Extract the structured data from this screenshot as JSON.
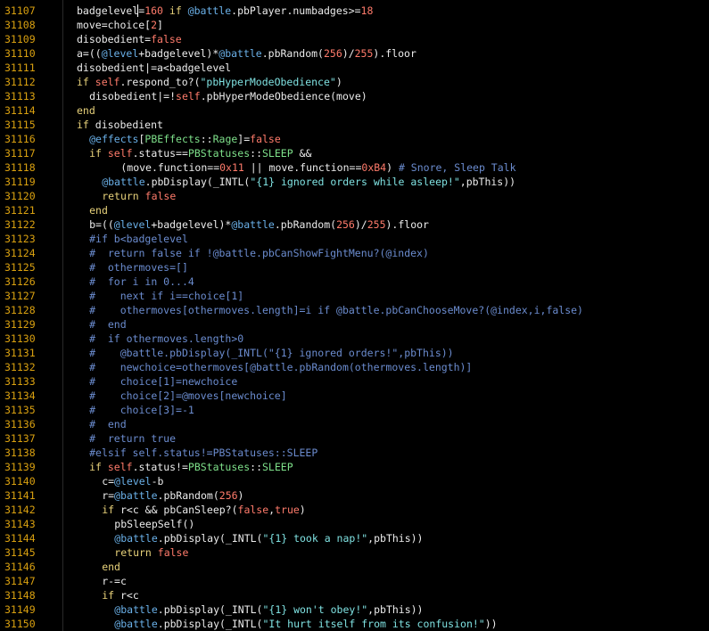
{
  "editor": {
    "lines": [
      {
        "num": "31107",
        "indent": 4,
        "tokens": [
          [
            "badgelevel",
            "plain"
          ],
          [
            "",
            "cursor"
          ],
          [
            "=",
            "plain"
          ],
          [
            "160",
            "num"
          ],
          [
            " if ",
            "kw"
          ],
          [
            "@battle",
            "iv"
          ],
          [
            ".pbPlayer.numbadges>=",
            "plain"
          ],
          [
            "18",
            "num"
          ]
        ]
      },
      {
        "num": "31108",
        "indent": 4,
        "tokens": [
          [
            "move=choice[",
            "plain"
          ],
          [
            "2",
            "num"
          ],
          [
            "]",
            "plain"
          ]
        ]
      },
      {
        "num": "31109",
        "indent": 4,
        "tokens": [
          [
            "disobedient=",
            "plain"
          ],
          [
            "false",
            "num"
          ]
        ]
      },
      {
        "num": "31110",
        "indent": 4,
        "tokens": [
          [
            "a=((",
            "plain"
          ],
          [
            "@level",
            "iv"
          ],
          [
            "+badgelevel)*",
            "plain"
          ],
          [
            "@battle",
            "iv"
          ],
          [
            ".pbRandom(",
            "plain"
          ],
          [
            "256",
            "num"
          ],
          [
            ")/",
            "plain"
          ],
          [
            "255",
            "num"
          ],
          [
            ").floor",
            "plain"
          ]
        ]
      },
      {
        "num": "31111",
        "indent": 4,
        "tokens": [
          [
            "disobedient|=a<badgelevel",
            "plain"
          ]
        ]
      },
      {
        "num": "31112",
        "indent": 4,
        "tokens": [
          [
            "if ",
            "kw"
          ],
          [
            "self",
            "num"
          ],
          [
            ".respond_to?(",
            "plain"
          ],
          [
            "\"pbHyperModeObedience\"",
            "str"
          ],
          [
            ")",
            "plain"
          ]
        ]
      },
      {
        "num": "31113",
        "indent": 6,
        "tokens": [
          [
            "disobedient|=!",
            "plain"
          ],
          [
            "self",
            "num"
          ],
          [
            ".pbHyperModeObedience(move)",
            "plain"
          ]
        ]
      },
      {
        "num": "31114",
        "indent": 4,
        "tokens": [
          [
            "end",
            "kw"
          ]
        ]
      },
      {
        "num": "31115",
        "indent": 4,
        "tokens": [
          [
            "if ",
            "kw"
          ],
          [
            "disobedient",
            "plain"
          ]
        ]
      },
      {
        "num": "31116",
        "indent": 6,
        "tokens": [
          [
            "@effects",
            "iv"
          ],
          [
            "[",
            "plain"
          ],
          [
            "PBEffects",
            "const"
          ],
          [
            "::",
            "plain"
          ],
          [
            "Rage",
            "const"
          ],
          [
            "]=",
            "plain"
          ],
          [
            "false",
            "num"
          ]
        ]
      },
      {
        "num": "31117",
        "indent": 6,
        "tokens": [
          [
            "if ",
            "kw"
          ],
          [
            "self",
            "num"
          ],
          [
            ".status==",
            "plain"
          ],
          [
            "PBStatuses",
            "const"
          ],
          [
            "::",
            "plain"
          ],
          [
            "SLEEP",
            "const"
          ],
          [
            " &&",
            "plain"
          ]
        ]
      },
      {
        "num": "31118",
        "indent": 11,
        "tokens": [
          [
            "(move.function==",
            "plain"
          ],
          [
            "0x11",
            "num"
          ],
          [
            " || move.function==",
            "plain"
          ],
          [
            "0xB4",
            "num"
          ],
          [
            ") ",
            "plain"
          ],
          [
            "# Snore, Sleep Talk",
            "cmt"
          ]
        ]
      },
      {
        "num": "31119",
        "indent": 8,
        "tokens": [
          [
            "@battle",
            "iv"
          ],
          [
            ".pbDisplay(_INTL(",
            "plain"
          ],
          [
            "\"{1} ignored orders while asleep!\"",
            "str"
          ],
          [
            ",pbThis))",
            "plain"
          ]
        ]
      },
      {
        "num": "31120",
        "indent": 8,
        "tokens": [
          [
            "return ",
            "kw"
          ],
          [
            "false",
            "num"
          ]
        ]
      },
      {
        "num": "31121",
        "indent": 6,
        "tokens": [
          [
            "end",
            "kw"
          ]
        ]
      },
      {
        "num": "31122",
        "indent": 6,
        "tokens": [
          [
            "b=((",
            "plain"
          ],
          [
            "@level",
            "iv"
          ],
          [
            "+badgelevel)*",
            "plain"
          ],
          [
            "@battle",
            "iv"
          ],
          [
            ".pbRandom(",
            "plain"
          ],
          [
            "256",
            "num"
          ],
          [
            ")/",
            "plain"
          ],
          [
            "255",
            "num"
          ],
          [
            ").floor",
            "plain"
          ]
        ]
      },
      {
        "num": "31123",
        "indent": 6,
        "tokens": [
          [
            "#if b<badgelevel",
            "cmt"
          ]
        ]
      },
      {
        "num": "31124",
        "indent": 6,
        "tokens": [
          [
            "#  return false if !@battle.pbCanShowFightMenu?(@index)",
            "cmt"
          ]
        ]
      },
      {
        "num": "31125",
        "indent": 6,
        "tokens": [
          [
            "#  othermoves=[]",
            "cmt"
          ]
        ]
      },
      {
        "num": "31126",
        "indent": 6,
        "tokens": [
          [
            "#  for i in 0...4",
            "cmt"
          ]
        ]
      },
      {
        "num": "31127",
        "indent": 6,
        "tokens": [
          [
            "#    next if i==choice[1]",
            "cmt"
          ]
        ]
      },
      {
        "num": "31128",
        "indent": 6,
        "tokens": [
          [
            "#    othermoves[othermoves.length]=i if @battle.pbCanChooseMove?(@index,i,false)",
            "cmt"
          ]
        ]
      },
      {
        "num": "31129",
        "indent": 6,
        "tokens": [
          [
            "#  end",
            "cmt"
          ]
        ]
      },
      {
        "num": "31130",
        "indent": 6,
        "tokens": [
          [
            "#  if othermoves.length>0",
            "cmt"
          ]
        ]
      },
      {
        "num": "31131",
        "indent": 6,
        "tokens": [
          [
            "#    @battle.pbDisplay(_INTL(\"{1} ignored orders!\",pbThis))",
            "cmt"
          ]
        ]
      },
      {
        "num": "31132",
        "indent": 6,
        "tokens": [
          [
            "#    newchoice=othermoves[@battle.pbRandom(othermoves.length)]",
            "cmt"
          ]
        ]
      },
      {
        "num": "31133",
        "indent": 6,
        "tokens": [
          [
            "#    choice[1]=newchoice",
            "cmt"
          ]
        ]
      },
      {
        "num": "31134",
        "indent": 6,
        "tokens": [
          [
            "#    choice[2]=@moves[newchoice]",
            "cmt"
          ]
        ]
      },
      {
        "num": "31135",
        "indent": 6,
        "tokens": [
          [
            "#    choice[3]=-1",
            "cmt"
          ]
        ]
      },
      {
        "num": "31136",
        "indent": 6,
        "tokens": [
          [
            "#  end",
            "cmt"
          ]
        ]
      },
      {
        "num": "31137",
        "indent": 6,
        "tokens": [
          [
            "#  return true",
            "cmt"
          ]
        ]
      },
      {
        "num": "31138",
        "indent": 6,
        "tokens": [
          [
            "#elsif self.status!=PBStatuses::SLEEP",
            "cmt"
          ]
        ]
      },
      {
        "num": "31139",
        "indent": 6,
        "tokens": [
          [
            "if ",
            "kw"
          ],
          [
            "self",
            "num"
          ],
          [
            ".status!=",
            "plain"
          ],
          [
            "PBStatuses",
            "const"
          ],
          [
            "::",
            "plain"
          ],
          [
            "SLEEP",
            "const"
          ]
        ]
      },
      {
        "num": "31140",
        "indent": 8,
        "tokens": [
          [
            "c=",
            "plain"
          ],
          [
            "@level",
            "iv"
          ],
          [
            "-b",
            "plain"
          ]
        ]
      },
      {
        "num": "31141",
        "indent": 8,
        "tokens": [
          [
            "r=",
            "plain"
          ],
          [
            "@battle",
            "iv"
          ],
          [
            ".pbRandom(",
            "plain"
          ],
          [
            "256",
            "num"
          ],
          [
            ")",
            "plain"
          ]
        ]
      },
      {
        "num": "31142",
        "indent": 8,
        "tokens": [
          [
            "if ",
            "kw"
          ],
          [
            "r<c && pbCanSleep?(",
            "plain"
          ],
          [
            "false",
            "num"
          ],
          [
            ",",
            "plain"
          ],
          [
            "true",
            "num"
          ],
          [
            ")",
            "plain"
          ]
        ]
      },
      {
        "num": "31143",
        "indent": 10,
        "tokens": [
          [
            "pbSleepSelf()",
            "plain"
          ]
        ]
      },
      {
        "num": "31144",
        "indent": 10,
        "tokens": [
          [
            "@battle",
            "iv"
          ],
          [
            ".pbDisplay(_INTL(",
            "plain"
          ],
          [
            "\"{1} took a nap!\"",
            "str"
          ],
          [
            ",pbThis))",
            "plain"
          ]
        ]
      },
      {
        "num": "31145",
        "indent": 10,
        "tokens": [
          [
            "return ",
            "kw"
          ],
          [
            "false",
            "num"
          ]
        ]
      },
      {
        "num": "31146",
        "indent": 8,
        "tokens": [
          [
            "end",
            "kw"
          ]
        ]
      },
      {
        "num": "31147",
        "indent": 8,
        "tokens": [
          [
            "r-=c",
            "plain"
          ]
        ]
      },
      {
        "num": "31148",
        "indent": 8,
        "tokens": [
          [
            "if ",
            "kw"
          ],
          [
            "r<c",
            "plain"
          ]
        ]
      },
      {
        "num": "31149",
        "indent": 10,
        "tokens": [
          [
            "@battle",
            "iv"
          ],
          [
            ".pbDisplay(_INTL(",
            "plain"
          ],
          [
            "\"{1} won't obey!\"",
            "str"
          ],
          [
            ",pbThis))",
            "plain"
          ]
        ]
      },
      {
        "num": "31150",
        "indent": 10,
        "tokens": [
          [
            "@battle",
            "iv"
          ],
          [
            ".pbDisplay(_INTL(",
            "plain"
          ],
          [
            "\"It hurt itself from its confusion!\"",
            "str"
          ],
          [
            "))",
            "plain"
          ]
        ]
      }
    ]
  }
}
